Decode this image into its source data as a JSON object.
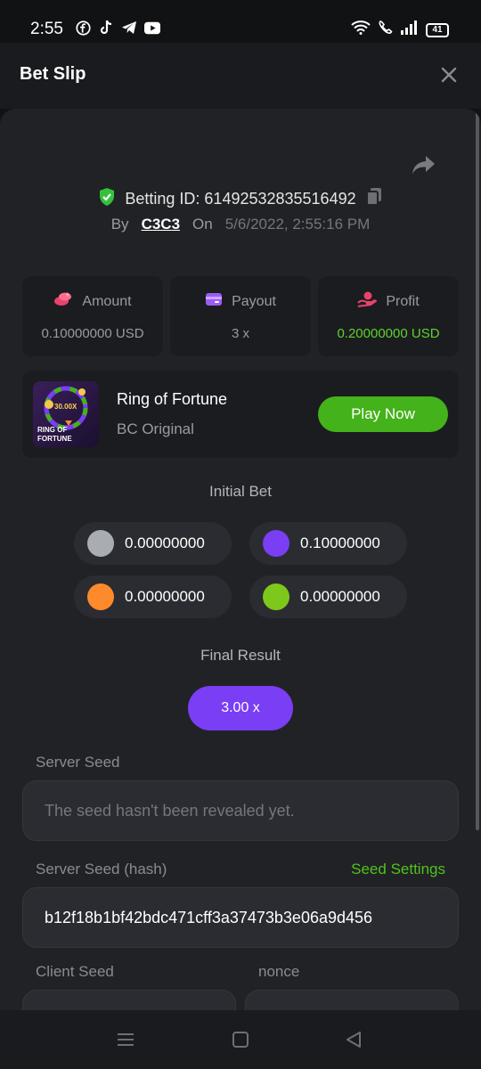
{
  "status_bar": {
    "time": "2:55",
    "battery": "41",
    "app_icons": [
      "facebook-icon",
      "tiktok-icon",
      "telegram-icon",
      "youtube-icon"
    ]
  },
  "header": {
    "title": "Bet Slip"
  },
  "bet": {
    "betting_id_label": "Betting ID: 61492532835516492",
    "by_label": "By",
    "user": "C3C3",
    "on_label": "On",
    "date": "5/6/2022, 2:55:16 PM"
  },
  "stats": [
    {
      "label": "Amount",
      "value": "0.10000000 USD"
    },
    {
      "label": "Payout",
      "value": "3 x"
    },
    {
      "label": "Profit",
      "value": "0.20000000 USD"
    }
  ],
  "game": {
    "title": "Ring of Fortune",
    "subtitle": "BC Original",
    "play_label": "Play Now",
    "thumb_text_1": "30.00X",
    "thumb_text_2": "RING OF",
    "thumb_text_3": "FORTUNE"
  },
  "initial_bet": {
    "label": "Initial Bet",
    "chips": [
      {
        "color": "#a9adb3",
        "value": "0.00000000"
      },
      {
        "color": "#7a3ef5",
        "value": "0.10000000"
      },
      {
        "color": "#ff8a2b",
        "value": "0.00000000"
      },
      {
        "color": "#7ec81b",
        "value": "0.00000000"
      }
    ]
  },
  "final_result": {
    "label": "Final Result",
    "value": "3.00 x"
  },
  "seeds": {
    "server_seed_label": "Server Seed",
    "server_seed_value": "The seed hasn't been revealed yet.",
    "server_seed_hash_label": "Server Seed (hash)",
    "seed_settings_link": "Seed Settings",
    "server_seed_hash_value": "b12f18b1bf42bdc471cff3a37473b3e06a9d456",
    "client_seed_label": "Client Seed",
    "nonce_label": "nonce"
  },
  "colors": {
    "accent_green": "#44b21a",
    "accent_purple": "#7a3ef5",
    "profit_green": "#5ed22c"
  }
}
